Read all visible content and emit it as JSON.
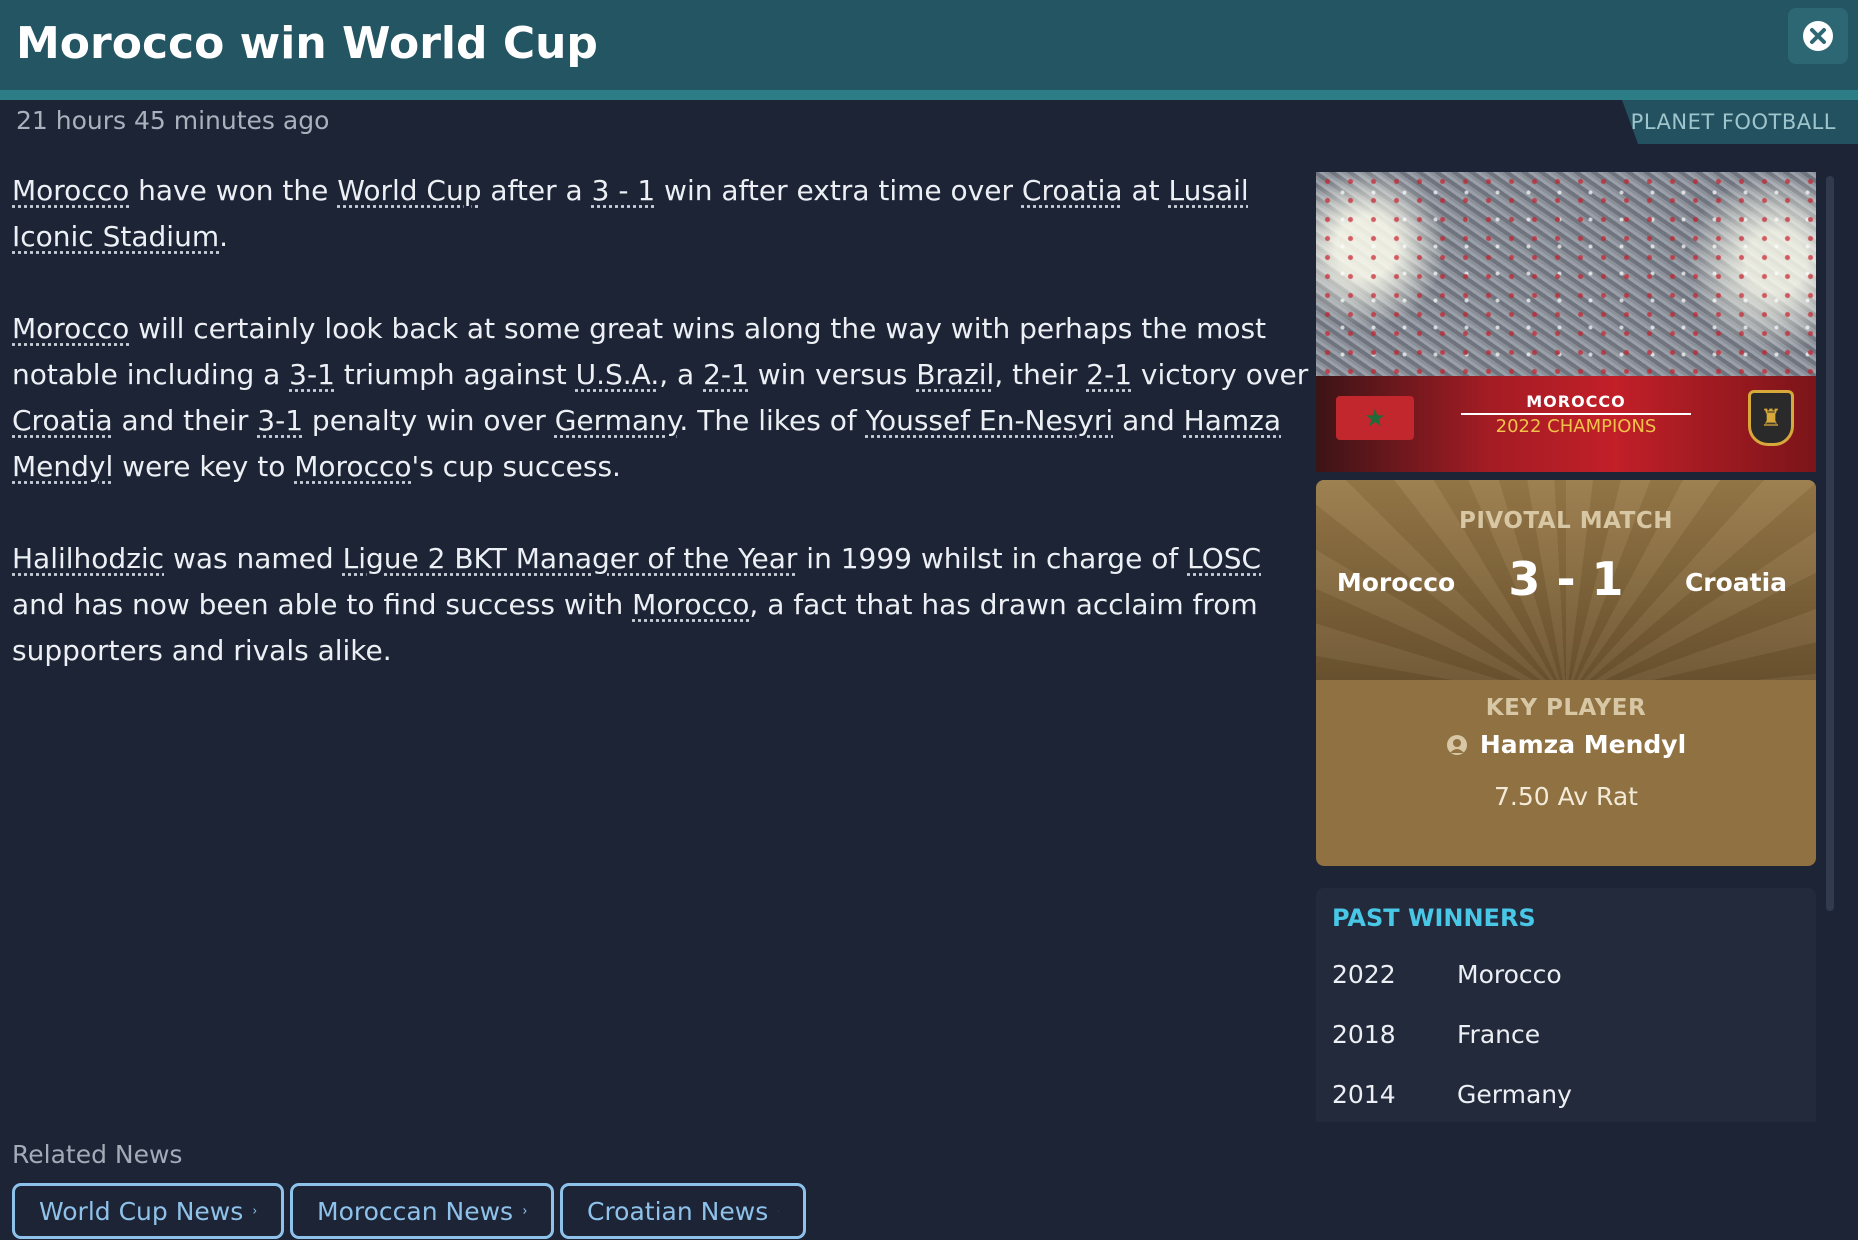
{
  "header": {
    "title": "Morocco win World Cup"
  },
  "meta": {
    "timestamp": "21 hours 45 minutes ago",
    "source": "PLANET FOOTBALL"
  },
  "article": {
    "p1": [
      "Morocco",
      " have won the ",
      "World Cup",
      " after a ",
      "3 - 1",
      " win after extra time over ",
      "Croatia",
      " at ",
      "Lusail Iconic Stadium",
      "."
    ],
    "p2": [
      "Morocco",
      " will certainly look back at some great wins along the way with perhaps the most notable including a ",
      "3-1",
      " triumph against ",
      "U.S.A.",
      ", a ",
      "2-1",
      " win versus ",
      "Brazil",
      ", their ",
      "2-1",
      " victory over ",
      "Croatia",
      " and their ",
      "3-1",
      " penalty win over ",
      "Germany",
      ". The likes of ",
      "Youssef En-Nesyri",
      " and ",
      "Hamza Mendyl",
      " were key to ",
      "Morocco",
      "'s cup success."
    ],
    "p3": [
      "Halilhodzic",
      " was named ",
      "Ligue 2 BKT Manager of the Year",
      " in 1999 whilst in charge of ",
      "LOSC",
      " and has now been able to find success with ",
      "Morocco",
      ", a fact that has drawn acclaim from supporters and rivals alike."
    ]
  },
  "photo": {
    "banner_line1": "MOROCCO",
    "banner_line2": "2022 CHAMPIONS"
  },
  "match_card": {
    "label": "PIVOTAL MATCH",
    "home_team": "Morocco",
    "score": "3 - 1",
    "away_team": "Croatia",
    "key_player_label": "KEY PLAYER",
    "key_player_name": "Hamza Mendyl",
    "key_player_rating": "7.50 Av Rat"
  },
  "past_winners": {
    "title": "PAST WINNERS",
    "rows": [
      {
        "year": "2022",
        "team": "Morocco"
      },
      {
        "year": "2018",
        "team": "France"
      },
      {
        "year": "2014",
        "team": "Germany"
      }
    ]
  },
  "related": {
    "label": "Related News",
    "buttons": [
      "World Cup News",
      "Moroccan News",
      "Croatian News"
    ]
  },
  "colors": {
    "background": "#1d2436",
    "header": "#245563",
    "accent_cyan": "#48c7e6",
    "link_button": "#8fc2ea",
    "card_gold": "#8f7142"
  }
}
